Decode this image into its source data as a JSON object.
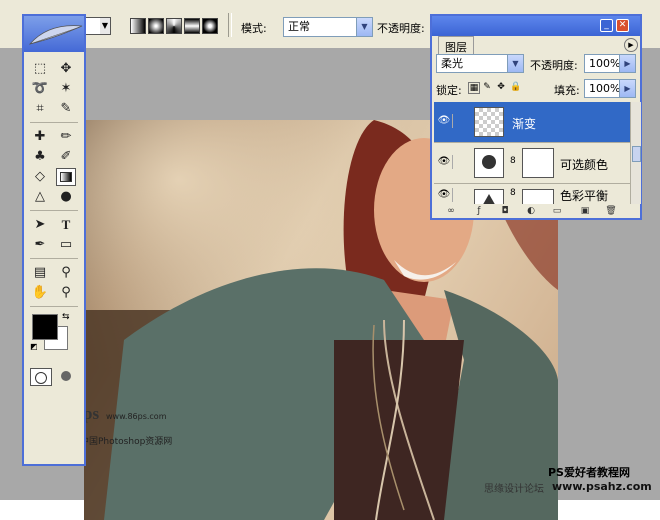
{
  "options_bar": {
    "gradient_types": [
      "linear-gradient-icon",
      "radial-gradient-icon",
      "angle-gradient-icon",
      "reflected-gradient-icon",
      "diamond-gradient-icon"
    ],
    "mode_label": "模式:",
    "mode_value": "正常",
    "opacity_label": "不透明度:"
  },
  "tools_palette": {
    "tools": [
      "marquee-tool",
      "move-tool",
      "lasso-tool",
      "magic-wand-tool",
      "crop-tool",
      "slice-tool",
      "healing-brush-tool",
      "brush-tool",
      "clone-stamp-tool",
      "history-brush-tool",
      "eraser-tool",
      "gradient-tool",
      "blur-tool",
      "dodge-tool",
      "path-selection-tool",
      "type-tool",
      "pen-tool",
      "shape-tool",
      "notes-tool",
      "eyedropper-tool",
      "hand-tool",
      "zoom-tool"
    ],
    "selected_tool": "gradient-tool",
    "foreground_color": "#000000",
    "background_color": "#ffffff"
  },
  "layers_panel": {
    "tab_label": "图层",
    "blend_mode": "柔光",
    "opacity_label": "不透明度:",
    "opacity_value": "100%",
    "lock_label": "锁定:",
    "fill_label": "填充:",
    "fill_value": "100%",
    "layers": [
      {
        "name": "渐变",
        "active": true,
        "visible": true
      },
      {
        "name": "可选颜色",
        "active": false,
        "visible": true
      },
      {
        "name": "色彩平衡",
        "active": false,
        "visible": true
      }
    ]
  },
  "watermarks": {
    "logo_text": "86ps",
    "site_url": "www.86ps.com",
    "site_name": "中国Photoshop资源网",
    "corner_title": "PS爱好者教程网",
    "corner_sub": "思缘设计论坛",
    "corner_url": "www.psahz.com"
  },
  "colors": {
    "accent": "#4d6fd8",
    "selection": "#3169c6",
    "panel_bg": "#ece9d8",
    "workspace": "#a8a8a8"
  }
}
